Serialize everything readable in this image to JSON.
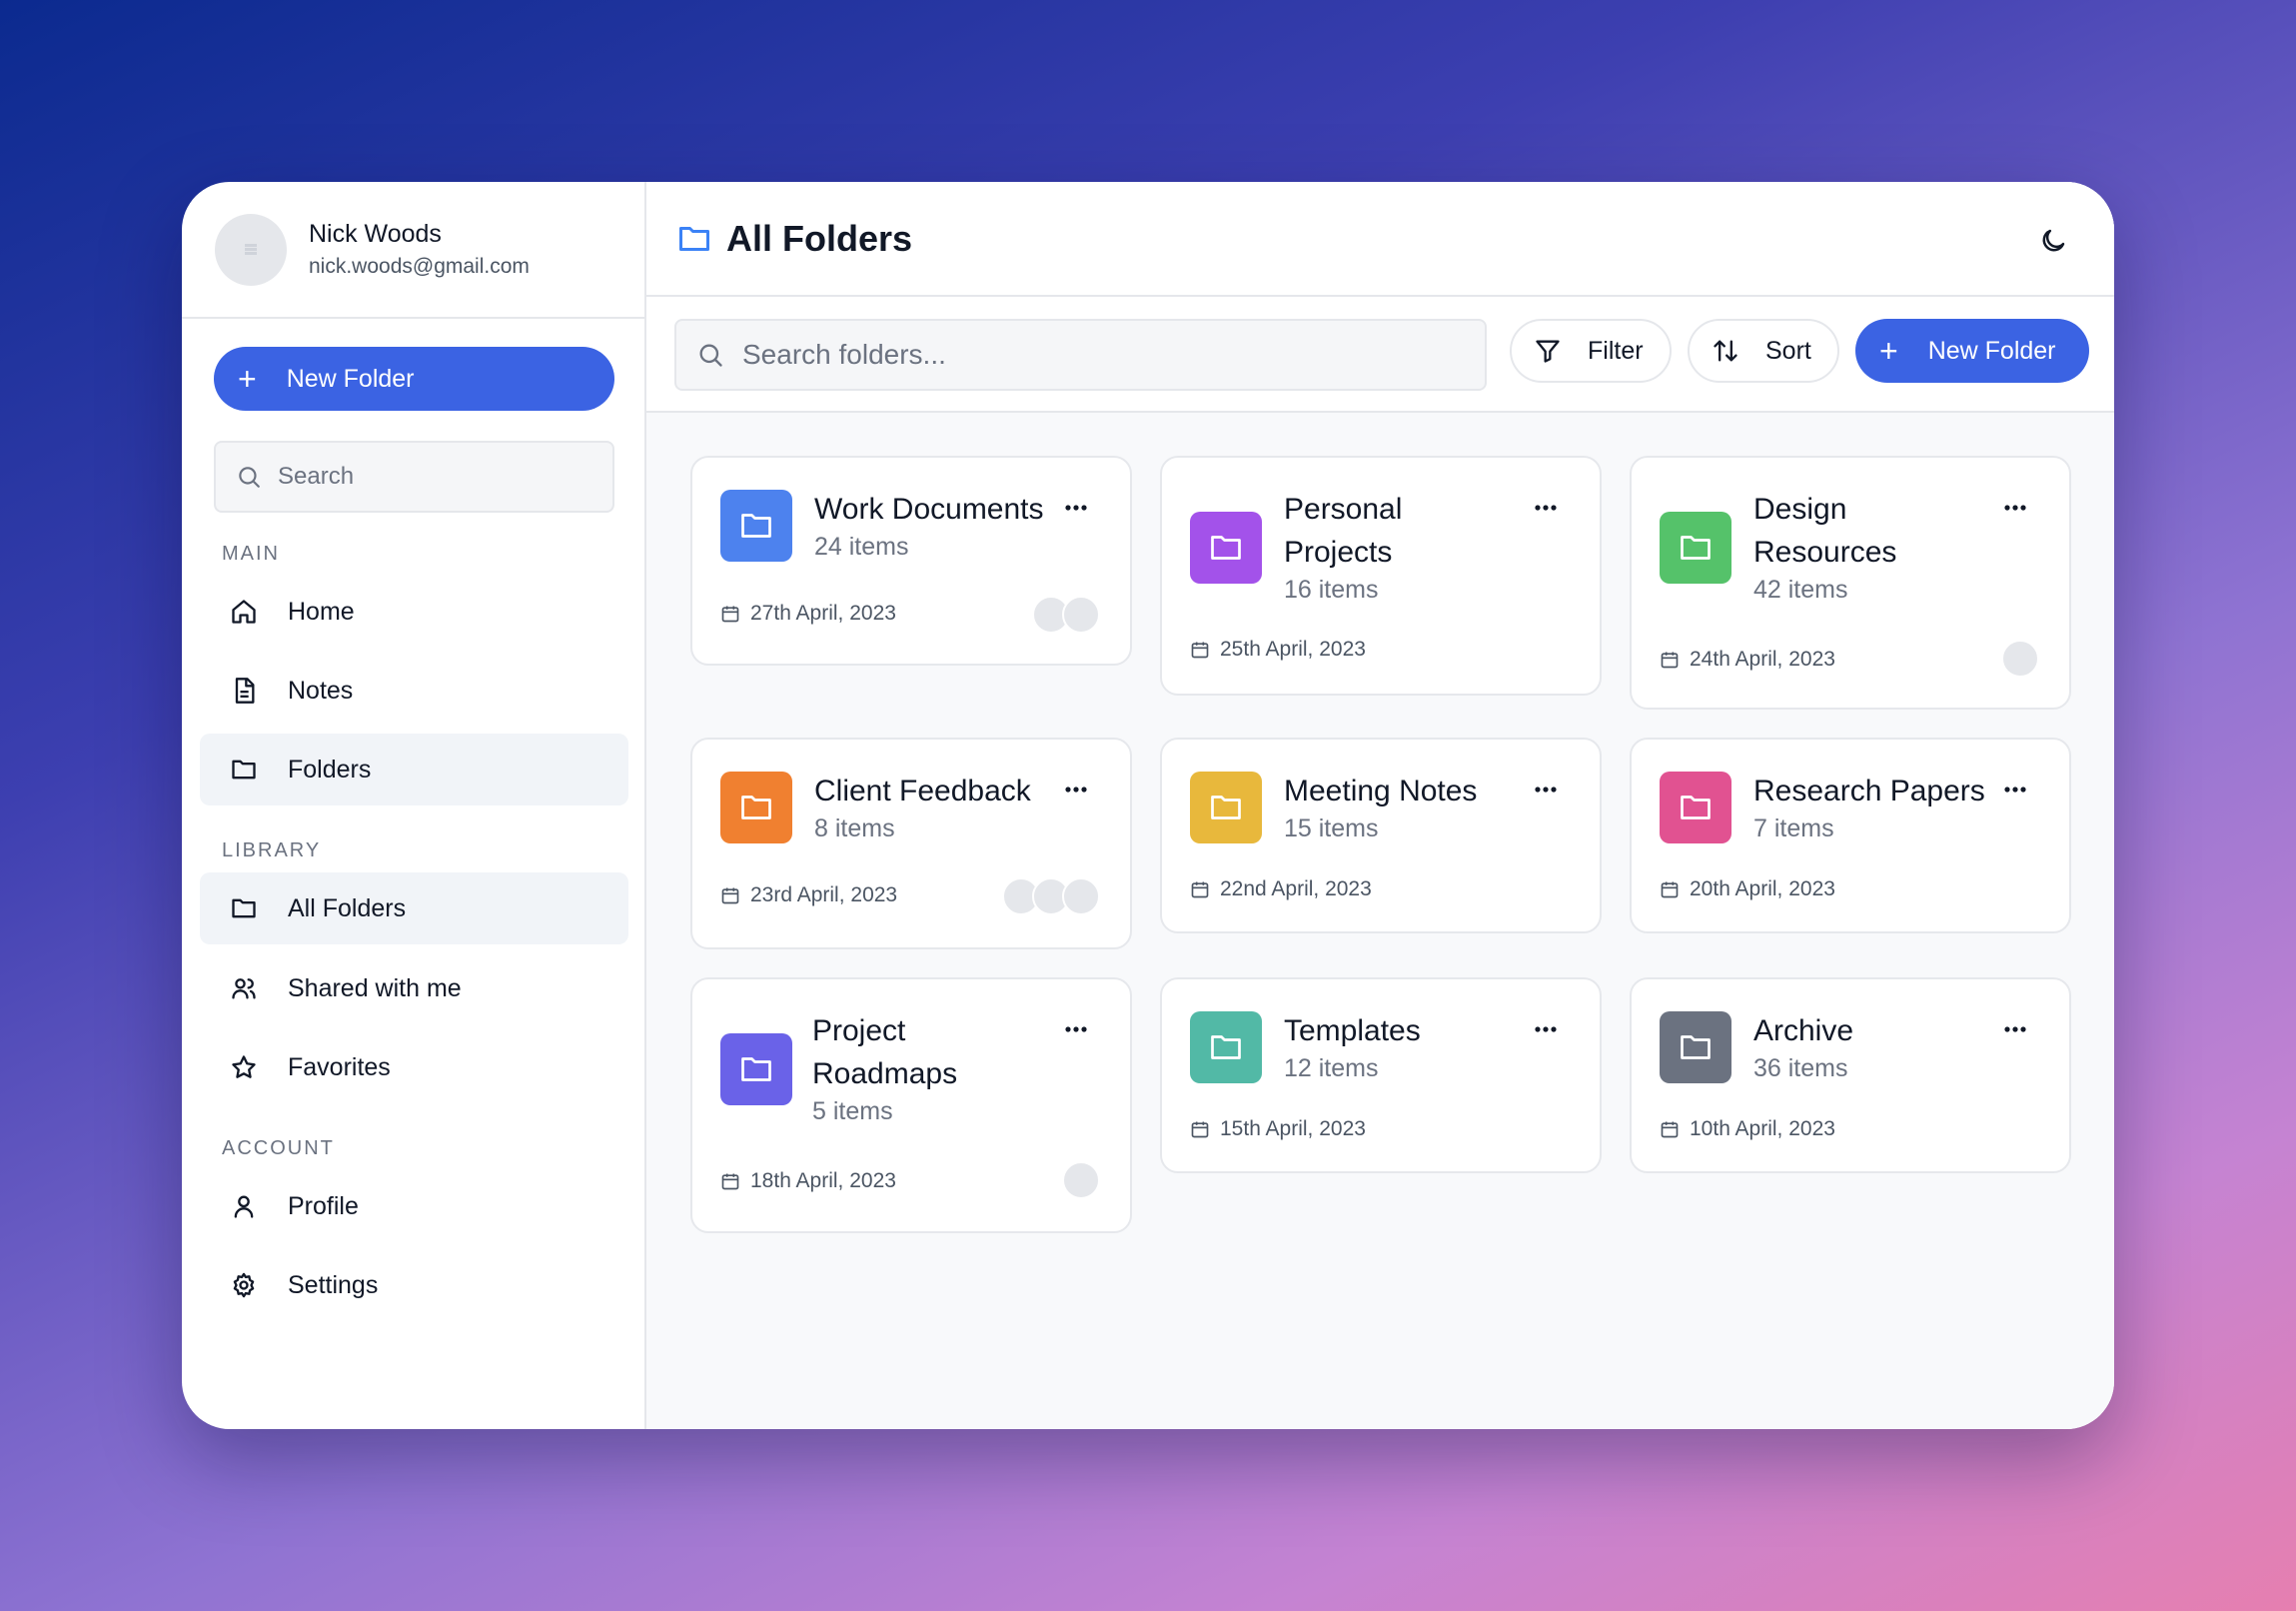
{
  "user": {
    "name": "Nick Woods",
    "email": "nick.woods@gmail.com"
  },
  "sidebar": {
    "new_folder_label": "New Folder",
    "search_placeholder": "Search",
    "sections": {
      "main": "MAIN",
      "library": "LIBRARY",
      "account": "ACCOUNT"
    },
    "items": {
      "home": "Home",
      "notes": "Notes",
      "folders": "Folders",
      "all_folders": "All Folders",
      "shared": "Shared with me",
      "favorites": "Favorites",
      "profile": "Profile",
      "settings": "Settings"
    },
    "active_items": [
      "Folders",
      "All Folders"
    ]
  },
  "header": {
    "title": "All Folders",
    "theme_toggle_icon": "moon-icon"
  },
  "toolbar": {
    "search_placeholder": "Search folders...",
    "filter_label": "Filter",
    "sort_label": "Sort",
    "new_folder_label": "New Folder"
  },
  "colors": {
    "accent": "#3b63e3",
    "blue": "#4d82ee",
    "purple": "#a352ea",
    "green": "#55c26a",
    "orange": "#f08030",
    "yellow": "#e8b83c",
    "pink": "#e15291",
    "indigo": "#6a62e8",
    "teal": "#52b9a6",
    "gray": "#6b7280"
  },
  "folders": [
    {
      "name": "Work Documents",
      "count": "24 items",
      "date": "27th April, 2023",
      "color": "blue",
      "avatars": 2
    },
    {
      "name": "Personal Projects",
      "count": "16 items",
      "date": "25th April, 2023",
      "color": "purple",
      "avatars": 0
    },
    {
      "name": "Design Resources",
      "count": "42 items",
      "date": "24th April, 2023",
      "color": "green",
      "avatars": 1
    },
    {
      "name": "Client Feedback",
      "count": "8 items",
      "date": "23rd April, 2023",
      "color": "orange",
      "avatars": 3
    },
    {
      "name": "Meeting Notes",
      "count": "15 items",
      "date": "22nd April, 2023",
      "color": "yellow",
      "avatars": 0
    },
    {
      "name": "Research Papers",
      "count": "7 items",
      "date": "20th April, 2023",
      "color": "pink",
      "avatars": 0
    },
    {
      "name": "Project Roadmaps",
      "count": "5 items",
      "date": "18th April, 2023",
      "color": "indigo",
      "avatars": 1
    },
    {
      "name": "Templates",
      "count": "12 items",
      "date": "15th April, 2023",
      "color": "teal",
      "avatars": 0
    },
    {
      "name": "Archive",
      "count": "36 items",
      "date": "10th April, 2023",
      "color": "gray",
      "avatars": 0
    }
  ]
}
